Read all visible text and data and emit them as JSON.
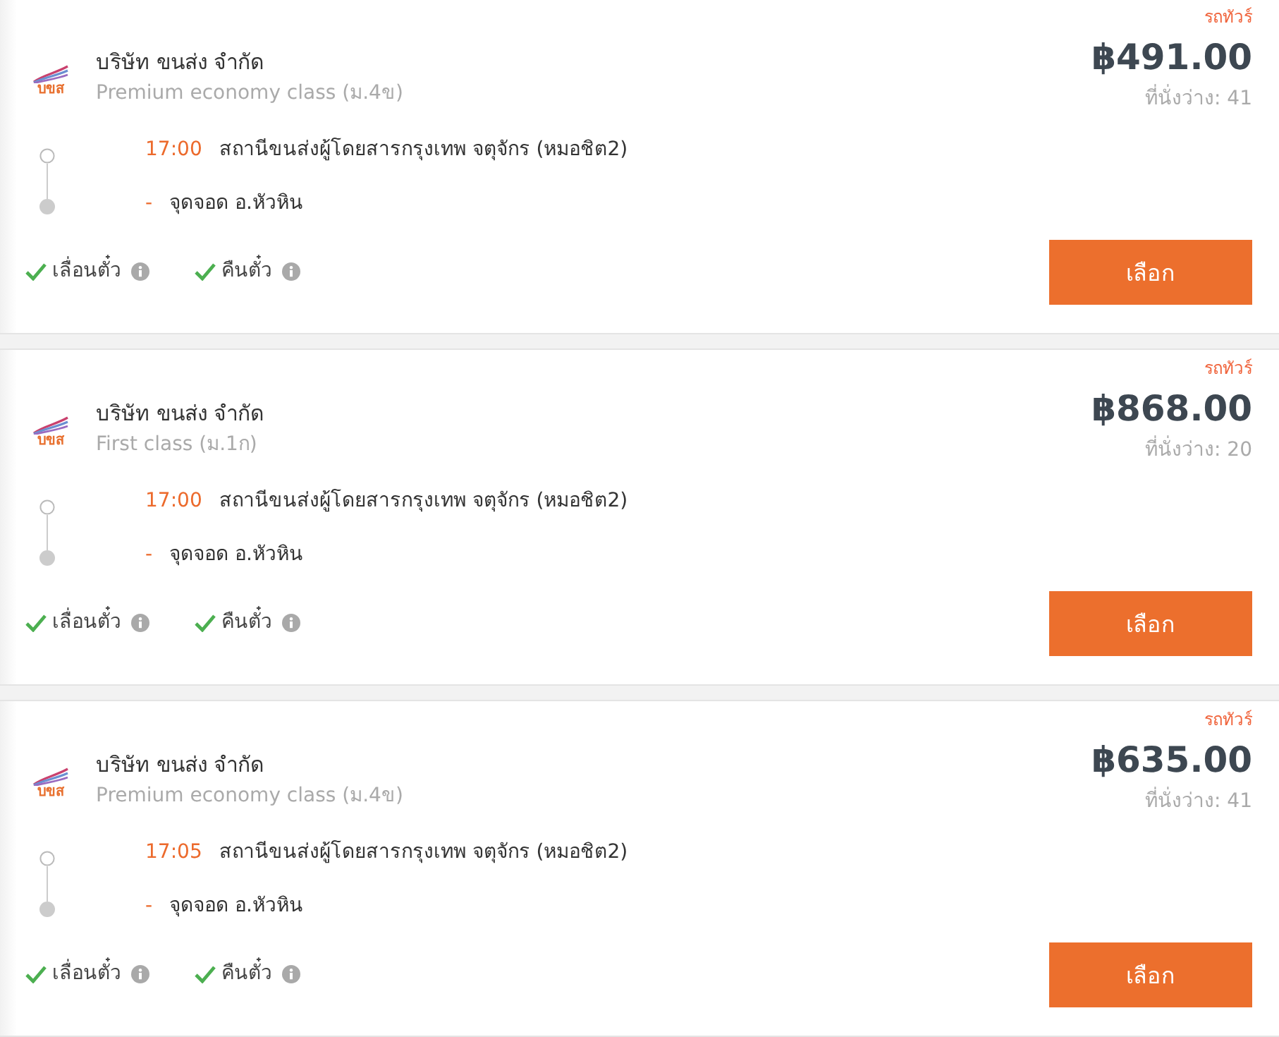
{
  "results": [
    {
      "vehicle_type": "รถทัวร์",
      "price": "฿491.00",
      "seats": "ที่นั่งว่าง: 41",
      "logo_text": "บขส",
      "company": "บริษัท ขนส่ง จำกัด",
      "class": "Premium economy class (ม.4ข)",
      "route": [
        {
          "kind": "departure",
          "time": "17:00",
          "place": "สถานีขนส่งผู้โดยสารกรุงเทพ จตุจักร (หมอชิต2)"
        },
        {
          "kind": "stop",
          "time": "-",
          "place": "จุดจอด อ.หัวหิน"
        }
      ],
      "features": [
        {
          "label": "เลื่อนตั๋ว",
          "available": true
        },
        {
          "label": "คืนตั๋ว",
          "available": true
        }
      ],
      "button": "เลือก"
    },
    {
      "vehicle_type": "รถทัวร์",
      "price": "฿868.00",
      "seats": "ที่นั่งว่าง: 20",
      "logo_text": "บขส",
      "company": "บริษัท ขนส่ง จำกัด",
      "class": "First class (ม.1ก)",
      "route": [
        {
          "kind": "departure",
          "time": "17:00",
          "place": "สถานีขนส่งผู้โดยสารกรุงเทพ จตุจักร (หมอชิต2)"
        },
        {
          "kind": "stop",
          "time": "-",
          "place": "จุดจอด อ.หัวหิน"
        }
      ],
      "features": [
        {
          "label": "เลื่อนตั๋ว",
          "available": true
        },
        {
          "label": "คืนตั๋ว",
          "available": true
        }
      ],
      "button": "เลือก"
    },
    {
      "vehicle_type": "รถทัวร์",
      "price": "฿635.00",
      "seats": "ที่นั่งว่าง: 41",
      "logo_text": "บขส",
      "company": "บริษัท ขนส่ง จำกัด",
      "class": "Premium economy class (ม.4ข)",
      "route": [
        {
          "kind": "departure",
          "time": "17:05",
          "place": "สถานีขนส่งผู้โดยสารกรุงเทพ จตุจักร (หมอชิต2)"
        },
        {
          "kind": "stop",
          "time": "-",
          "place": "จุดจอด อ.หัวหิน"
        }
      ],
      "features": [
        {
          "label": "เลื่อนตั๋ว",
          "available": true
        },
        {
          "label": "คืนตั๋ว",
          "available": true
        }
      ],
      "button": "เลือก"
    }
  ]
}
